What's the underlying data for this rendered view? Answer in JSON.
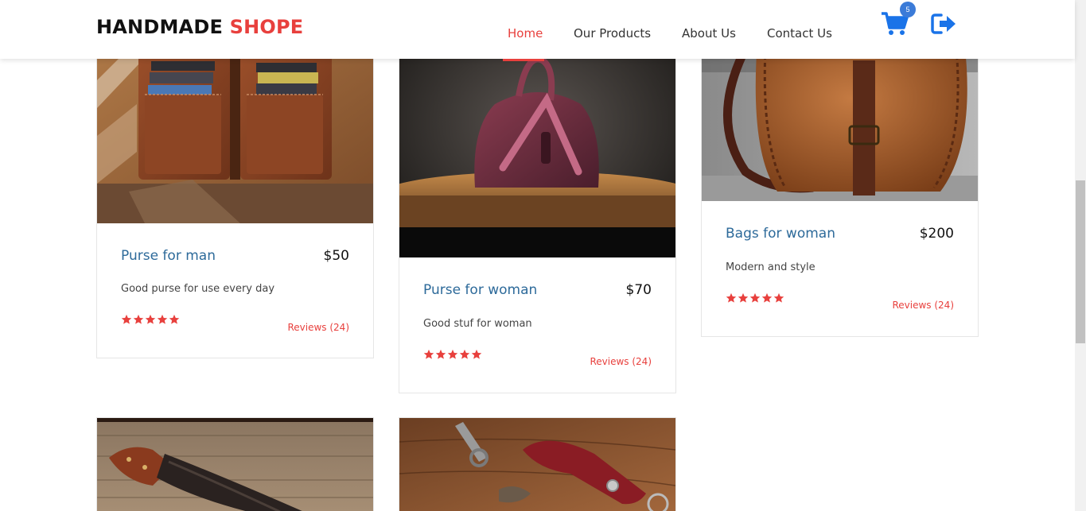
{
  "header": {
    "brand_main": "HANDMADE",
    "brand_accent": "SHOPE",
    "nav": [
      "Home",
      "Our Products",
      "About Us",
      "Contact Us"
    ],
    "active_nav": "Home",
    "cart_count": "5"
  },
  "products": [
    {
      "title": "Purse for man",
      "price": "$50",
      "desc": "Good purse for use every day",
      "rating": 5,
      "reviews": "Reviews (24)"
    },
    {
      "title": "Purse for woman",
      "price": "$70",
      "desc": "Good stuf for woman",
      "rating": 5,
      "reviews": "Reviews (24)"
    },
    {
      "title": "Bags for woman",
      "price": "$200",
      "desc": "Modern and style",
      "rating": 5,
      "reviews": "Reviews (24)"
    }
  ],
  "colors": {
    "accent": "#e8403d",
    "title_blue": "#2d6a9a",
    "icon_blue": "#1a73e8"
  }
}
